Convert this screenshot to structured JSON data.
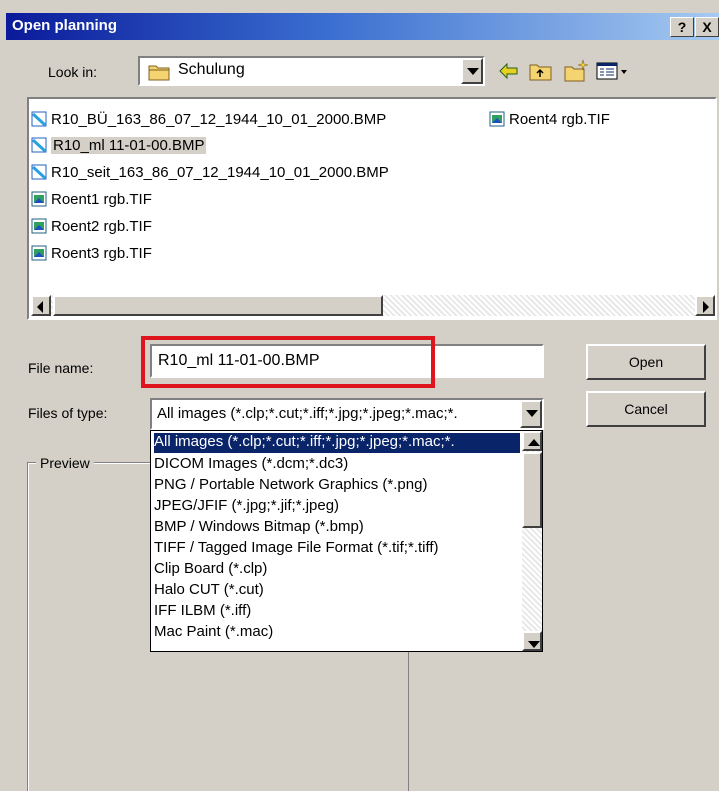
{
  "window": {
    "title": "Open planning",
    "help_button": "?",
    "close_button": "X"
  },
  "look_in": {
    "label": "Look in:",
    "value": "Schulung"
  },
  "toolbar": {
    "icons": [
      "back-arrow-icon",
      "up-folder-icon",
      "new-folder-icon",
      "view-menu-icon"
    ]
  },
  "files": [
    {
      "name": "R10_BÜ_163_86_07_12_1944_10_01_2000.BMP",
      "type": "bmp",
      "selected": false
    },
    {
      "name": "R10_ml 11-01-00.BMP",
      "type": "bmp",
      "selected": true
    },
    {
      "name": "R10_seit_163_86_07_12_1944_10_01_2000.BMP",
      "type": "bmp",
      "selected": false
    },
    {
      "name": "Roent1 rgb.TIF",
      "type": "tif",
      "selected": false
    },
    {
      "name": "Roent2 rgb.TIF",
      "type": "tif",
      "selected": false
    },
    {
      "name": "Roent3 rgb.TIF",
      "type": "tif",
      "selected": false
    },
    {
      "name": "Roent4 rgb.TIF",
      "type": "tif",
      "selected": false
    }
  ],
  "file_name": {
    "label": "File name:",
    "value": "R10_ml 11-01-00.BMP"
  },
  "files_of_type": {
    "label": "Files of type:",
    "value": "All images (*.clp;*.cut;*.iff;*.jpg;*.jpeg;*.mac;*.",
    "options": [
      "All images (*.clp;*.cut;*.iff;*.jpg;*.jpeg;*.mac;*.",
      "DICOM Images (*.dcm;*.dc3)",
      "PNG / Portable Network Graphics  (*.png)",
      "JPEG/JFIF  (*.jpg;*.jif;*.jpeg)",
      "BMP / Windows Bitmap  (*.bmp)",
      "TIFF / Tagged Image File Format  (*.tif;*.tiff)",
      "Clip Board  (*.clp)",
      "Halo CUT  (*.cut)",
      "IFF ILBM  (*.iff)",
      "Mac Paint  (*.mac)"
    ]
  },
  "buttons": {
    "open": "Open",
    "cancel": "Cancel"
  },
  "preview": {
    "label": "Preview"
  },
  "colors": {
    "title_bar_start": "#0a1a9a",
    "selection": "#0a246a",
    "highlight_box": "#e0141c",
    "dialog_face": "#d4d0c8"
  }
}
